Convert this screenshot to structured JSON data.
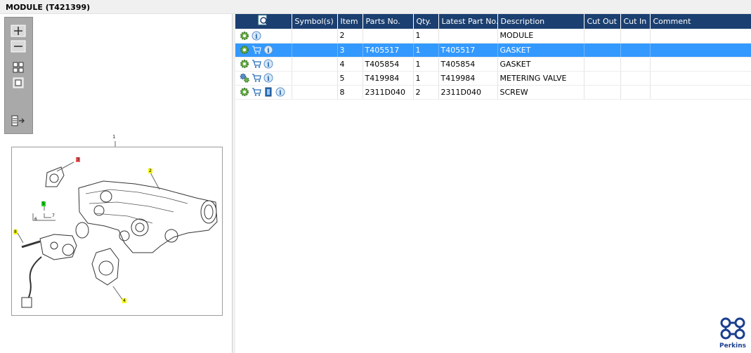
{
  "window": {
    "title": "MODULE (T421399)"
  },
  "toolbar": {
    "buttons": [
      "zoom-in",
      "zoom-out",
      "fit-all",
      "fit-window",
      "export"
    ]
  },
  "diagram": {
    "top_label": "1",
    "labels": {
      "l1": "1",
      "l2": "2",
      "l3": "3",
      "l4": "4",
      "l5": "5",
      "l6": "6",
      "l7": "7",
      "l8": "8"
    }
  },
  "table": {
    "headers": [
      "",
      "Symbol(s)",
      "Item",
      "Parts No.",
      "Qty.",
      "Latest Part No.",
      "Description",
      "Cut Out",
      "Cut In",
      "Comment"
    ],
    "rows": [
      {
        "icons": [
          "gear-icon",
          "info-icon"
        ],
        "item": "2",
        "part_no": "",
        "qty": "1",
        "latest": "",
        "description": "MODULE",
        "selected": false
      },
      {
        "icons": [
          "gear-icon",
          "cart-icon",
          "info-icon"
        ],
        "item": "3",
        "part_no": "T405517",
        "qty": "1",
        "latest": "T405517",
        "description": "GASKET",
        "selected": true
      },
      {
        "icons": [
          "gear-icon",
          "cart-icon",
          "info-icon"
        ],
        "item": "4",
        "part_no": "T405854",
        "qty": "1",
        "latest": "T405854",
        "description": "GASKET",
        "selected": false
      },
      {
        "icons": [
          "gears-icon",
          "cart-icon",
          "info-icon"
        ],
        "item": "5",
        "part_no": "T419984",
        "qty": "1",
        "latest": "T419984",
        "description": "METERING VALVE",
        "selected": false
      },
      {
        "icons": [
          "gear-icon",
          "cart-icon",
          "document-icon",
          "info-icon"
        ],
        "item": "8",
        "part_no": "2311D040",
        "qty": "2",
        "latest": "2311D040",
        "description": "SCREW",
        "selected": false
      }
    ]
  },
  "brand": {
    "name": "Perkins",
    "color": "#1b3f8f"
  },
  "colors": {
    "header": "#1b3f70",
    "selected": "#3399ff"
  }
}
